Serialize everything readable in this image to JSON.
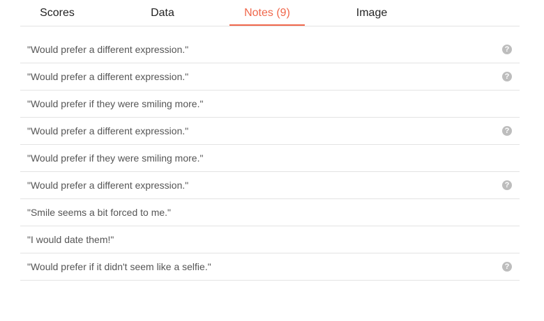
{
  "tabs": [
    {
      "label": "Scores",
      "active": false
    },
    {
      "label": "Data",
      "active": false
    },
    {
      "label": "Notes (9)",
      "active": true
    },
    {
      "label": "Image",
      "active": false
    }
  ],
  "colors": {
    "accent": "#f0674b",
    "divider": "#e3e3e3",
    "note_text": "#555555",
    "icon": "#bdbdbd"
  },
  "help_icon_glyph": "?",
  "notes": [
    {
      "text": "\"Would prefer a different expression.\"",
      "has_help": true
    },
    {
      "text": "\"Would prefer a different expression.\"",
      "has_help": true
    },
    {
      "text": "\"Would prefer if they were smiling more.\"",
      "has_help": false
    },
    {
      "text": "\"Would prefer a different expression.\"",
      "has_help": true
    },
    {
      "text": "\"Would prefer if they were smiling more.\"",
      "has_help": false
    },
    {
      "text": "\"Would prefer a different expression.\"",
      "has_help": true
    },
    {
      "text": "\"Smile seems a bit forced to me.\"",
      "has_help": false
    },
    {
      "text": "\"I would date them!\"",
      "has_help": false
    },
    {
      "text": "\"Would prefer if it didn't seem like a selfie.\"",
      "has_help": true
    }
  ]
}
